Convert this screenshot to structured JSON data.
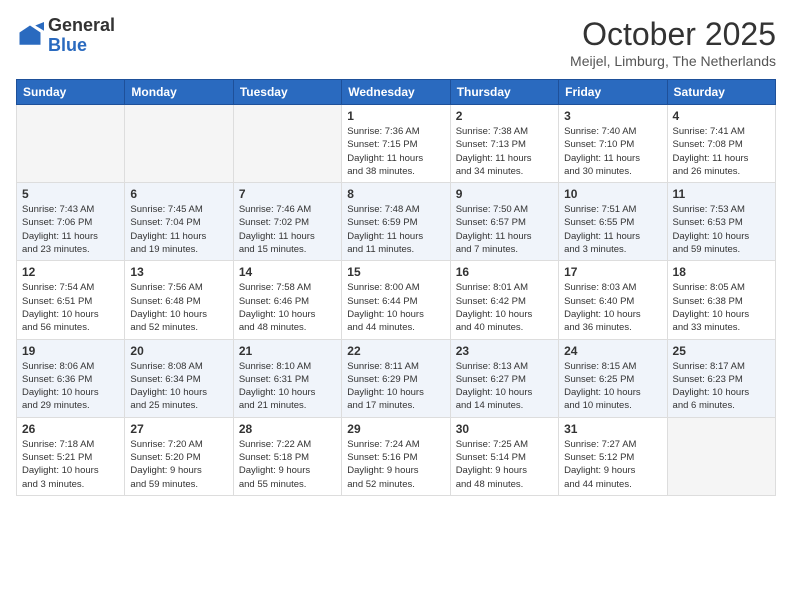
{
  "header": {
    "logo_general": "General",
    "logo_blue": "Blue",
    "month": "October 2025",
    "location": "Meijel, Limburg, The Netherlands"
  },
  "weekdays": [
    "Sunday",
    "Monday",
    "Tuesday",
    "Wednesday",
    "Thursday",
    "Friday",
    "Saturday"
  ],
  "weeks": [
    [
      {
        "day": "",
        "info": ""
      },
      {
        "day": "",
        "info": ""
      },
      {
        "day": "",
        "info": ""
      },
      {
        "day": "1",
        "info": "Sunrise: 7:36 AM\nSunset: 7:15 PM\nDaylight: 11 hours\nand 38 minutes."
      },
      {
        "day": "2",
        "info": "Sunrise: 7:38 AM\nSunset: 7:13 PM\nDaylight: 11 hours\nand 34 minutes."
      },
      {
        "day": "3",
        "info": "Sunrise: 7:40 AM\nSunset: 7:10 PM\nDaylight: 11 hours\nand 30 minutes."
      },
      {
        "day": "4",
        "info": "Sunrise: 7:41 AM\nSunset: 7:08 PM\nDaylight: 11 hours\nand 26 minutes."
      }
    ],
    [
      {
        "day": "5",
        "info": "Sunrise: 7:43 AM\nSunset: 7:06 PM\nDaylight: 11 hours\nand 23 minutes."
      },
      {
        "day": "6",
        "info": "Sunrise: 7:45 AM\nSunset: 7:04 PM\nDaylight: 11 hours\nand 19 minutes."
      },
      {
        "day": "7",
        "info": "Sunrise: 7:46 AM\nSunset: 7:02 PM\nDaylight: 11 hours\nand 15 minutes."
      },
      {
        "day": "8",
        "info": "Sunrise: 7:48 AM\nSunset: 6:59 PM\nDaylight: 11 hours\nand 11 minutes."
      },
      {
        "day": "9",
        "info": "Sunrise: 7:50 AM\nSunset: 6:57 PM\nDaylight: 11 hours\nand 7 minutes."
      },
      {
        "day": "10",
        "info": "Sunrise: 7:51 AM\nSunset: 6:55 PM\nDaylight: 11 hours\nand 3 minutes."
      },
      {
        "day": "11",
        "info": "Sunrise: 7:53 AM\nSunset: 6:53 PM\nDaylight: 10 hours\nand 59 minutes."
      }
    ],
    [
      {
        "day": "12",
        "info": "Sunrise: 7:54 AM\nSunset: 6:51 PM\nDaylight: 10 hours\nand 56 minutes."
      },
      {
        "day": "13",
        "info": "Sunrise: 7:56 AM\nSunset: 6:48 PM\nDaylight: 10 hours\nand 52 minutes."
      },
      {
        "day": "14",
        "info": "Sunrise: 7:58 AM\nSunset: 6:46 PM\nDaylight: 10 hours\nand 48 minutes."
      },
      {
        "day": "15",
        "info": "Sunrise: 8:00 AM\nSunset: 6:44 PM\nDaylight: 10 hours\nand 44 minutes."
      },
      {
        "day": "16",
        "info": "Sunrise: 8:01 AM\nSunset: 6:42 PM\nDaylight: 10 hours\nand 40 minutes."
      },
      {
        "day": "17",
        "info": "Sunrise: 8:03 AM\nSunset: 6:40 PM\nDaylight: 10 hours\nand 36 minutes."
      },
      {
        "day": "18",
        "info": "Sunrise: 8:05 AM\nSunset: 6:38 PM\nDaylight: 10 hours\nand 33 minutes."
      }
    ],
    [
      {
        "day": "19",
        "info": "Sunrise: 8:06 AM\nSunset: 6:36 PM\nDaylight: 10 hours\nand 29 minutes."
      },
      {
        "day": "20",
        "info": "Sunrise: 8:08 AM\nSunset: 6:34 PM\nDaylight: 10 hours\nand 25 minutes."
      },
      {
        "day": "21",
        "info": "Sunrise: 8:10 AM\nSunset: 6:31 PM\nDaylight: 10 hours\nand 21 minutes."
      },
      {
        "day": "22",
        "info": "Sunrise: 8:11 AM\nSunset: 6:29 PM\nDaylight: 10 hours\nand 17 minutes."
      },
      {
        "day": "23",
        "info": "Sunrise: 8:13 AM\nSunset: 6:27 PM\nDaylight: 10 hours\nand 14 minutes."
      },
      {
        "day": "24",
        "info": "Sunrise: 8:15 AM\nSunset: 6:25 PM\nDaylight: 10 hours\nand 10 minutes."
      },
      {
        "day": "25",
        "info": "Sunrise: 8:17 AM\nSunset: 6:23 PM\nDaylight: 10 hours\nand 6 minutes."
      }
    ],
    [
      {
        "day": "26",
        "info": "Sunrise: 7:18 AM\nSunset: 5:21 PM\nDaylight: 10 hours\nand 3 minutes."
      },
      {
        "day": "27",
        "info": "Sunrise: 7:20 AM\nSunset: 5:20 PM\nDaylight: 9 hours\nand 59 minutes."
      },
      {
        "day": "28",
        "info": "Sunrise: 7:22 AM\nSunset: 5:18 PM\nDaylight: 9 hours\nand 55 minutes."
      },
      {
        "day": "29",
        "info": "Sunrise: 7:24 AM\nSunset: 5:16 PM\nDaylight: 9 hours\nand 52 minutes."
      },
      {
        "day": "30",
        "info": "Sunrise: 7:25 AM\nSunset: 5:14 PM\nDaylight: 9 hours\nand 48 minutes."
      },
      {
        "day": "31",
        "info": "Sunrise: 7:27 AM\nSunset: 5:12 PM\nDaylight: 9 hours\nand 44 minutes."
      },
      {
        "day": "",
        "info": ""
      }
    ]
  ]
}
